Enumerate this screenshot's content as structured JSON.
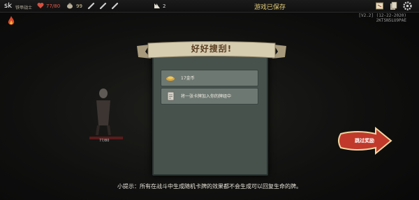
{
  "topbar": {
    "player_name": "sk",
    "player_class": "铁甲战士",
    "hp": "77/80",
    "gold": "99",
    "deck_count": "2",
    "save_status": "游戏已保存"
  },
  "version": {
    "line1": "[V2.2] (12-22-2020)",
    "line2": "2KTSN5LU9PAE"
  },
  "enemy": {
    "hp": "77/80"
  },
  "rewards": {
    "title": "好好搜刮!",
    "items": [
      {
        "label": "17金币",
        "icon": "gold-coin-icon"
      },
      {
        "label": "将一张卡牌加入你的牌组中",
        "icon": "card-icon"
      }
    ]
  },
  "skip_button": {
    "label": "跳过奖励"
  },
  "tip": "小提示：所有在战斗中生成随机卡牌的效果都不会生成可以回复生命的牌。",
  "colors": {
    "panel": "#47524d",
    "banner": "#d6ccb0",
    "skip": "#c0392b",
    "saved_text": "#e6cf7a"
  }
}
